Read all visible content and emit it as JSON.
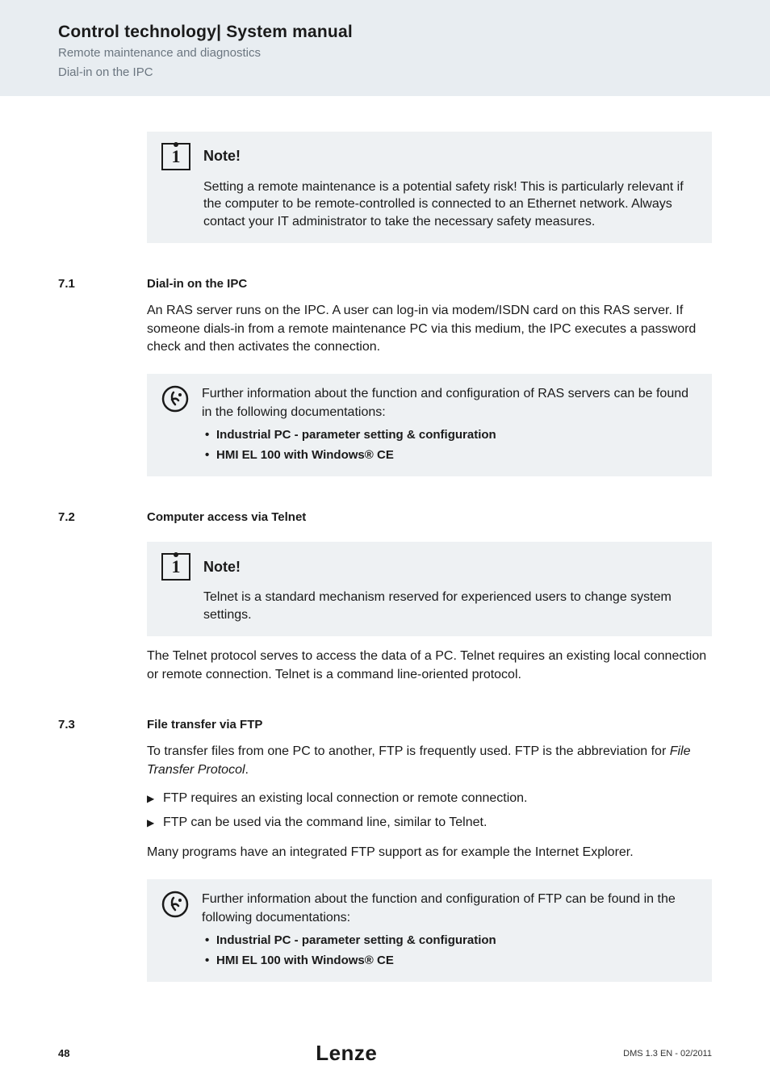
{
  "header": {
    "title": "Control technology| System manual",
    "sub1": "Remote maintenance and diagnostics",
    "sub2": "Dial-in on the IPC"
  },
  "note1": {
    "label": "Note!",
    "body": "Setting a remote maintenance is a potential safety risk! This is particularly relevant if the computer to be remote-controlled is connected to an Ethernet network. Always contact your IT administrator to take the necessary safety measures."
  },
  "sec71": {
    "num": "7.1",
    "title": "Dial-in on the IPC",
    "p1": "An RAS server runs on the IPC. A user can log-in via modem/ISDN card on this RAS server. If someone dials-in from a remote maintenance PC via this medium, the IPC executes a password check and then activates the connection.",
    "tip_intro": "Further information about the function and configuration of RAS servers can be found in the following documentations:",
    "tip_items": [
      "Industrial PC - parameter setting & configuration",
      "HMI EL 100 with Windows® CE"
    ]
  },
  "sec72": {
    "num": "7.2",
    "title": "Computer access via Telnet",
    "note_label": "Note!",
    "note_body": "Telnet is a standard mechanism reserved for experienced users to change system settings.",
    "p1": "The Telnet protocol serves to access the data of a PC. Telnet requires an existing local connection or remote connection. Telnet is a command line-oriented protocol."
  },
  "sec73": {
    "num": "7.3",
    "title": "File transfer via FTP",
    "p1_a": "To transfer files from one PC to another, FTP is frequently used. FTP is the abbreviation for ",
    "p1_b": "File Transfer Protocol",
    "p1_c": ".",
    "bullets": [
      "FTP requires an existing local connection or remote connection.",
      "FTP can be used via the command line, similar to Telnet."
    ],
    "p2": "Many programs have an integrated FTP support as for example the Internet Explorer.",
    "tip_intro": "Further information about the function and configuration of FTP can be found in the following documentations:",
    "tip_items": [
      "Industrial PC - parameter setting & configuration",
      "HMI EL 100 with Windows® CE"
    ]
  },
  "footer": {
    "page": "48",
    "logo": "Lenze",
    "docid": "DMS 1.3 EN - 02/2011"
  }
}
